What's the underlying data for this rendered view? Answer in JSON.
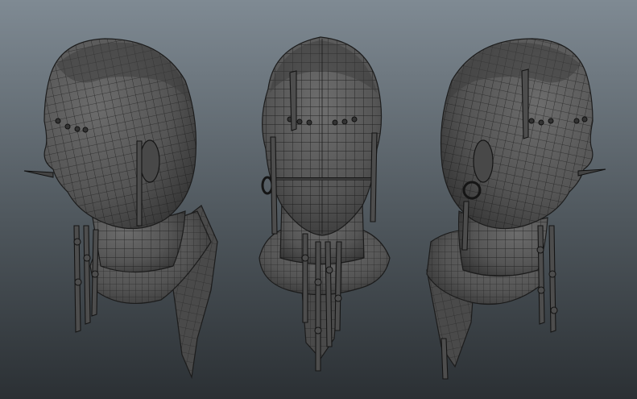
{
  "viewport": {
    "background_top": "#7f8a93",
    "background_bottom": "#2b3034",
    "mesh_fill": "#565656",
    "mesh_shadow": "#3a3a3a",
    "mesh_highlight": "#6e6e6e",
    "wire_color": "#1a1a1a",
    "views": [
      "three-quarter-left",
      "front",
      "three-quarter-right"
    ]
  }
}
